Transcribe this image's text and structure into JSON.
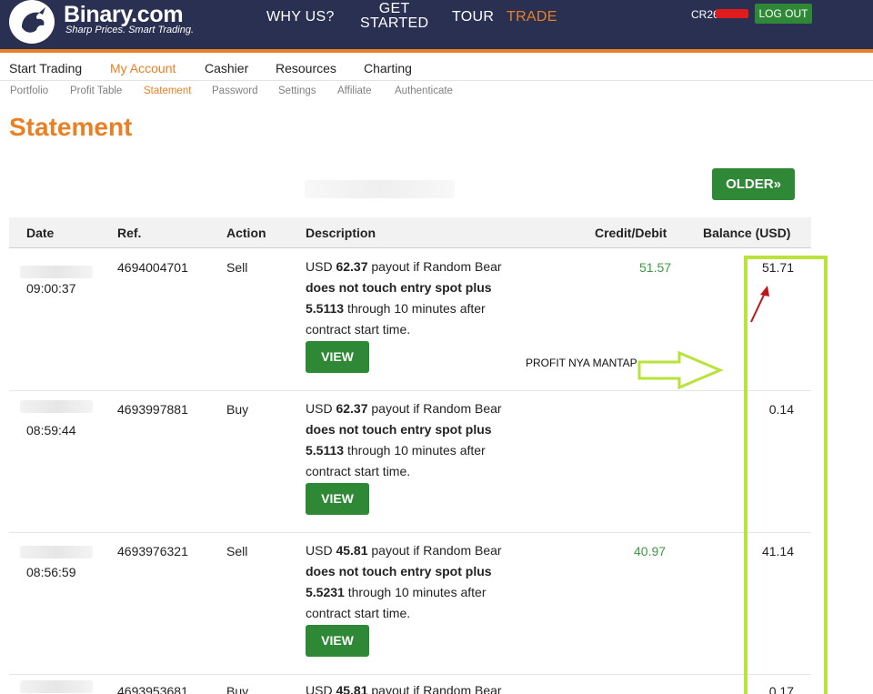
{
  "header": {
    "brand": "Binary.com",
    "tagline": "Sharp Prices. Smart Trading.",
    "nav": [
      {
        "label": "WHY US?"
      },
      {
        "label_line1": "GET",
        "label_line2": "STARTED"
      },
      {
        "label": "TOUR"
      },
      {
        "label": "TRADE"
      }
    ],
    "account_id_visible": "CR26",
    "logout_label": "LOG OUT"
  },
  "main_menu": [
    "Start Trading",
    "My Account",
    "Cashier",
    "Resources",
    "Charting"
  ],
  "sub_menu": [
    "Portfolio",
    "Profit Table",
    "Statement",
    "Password",
    "Settings",
    "Affiliate",
    "Authenticate"
  ],
  "page_title": "Statement",
  "older_button": "OLDER»",
  "table": {
    "columns": [
      "Date",
      "Ref.",
      "Action",
      "Description",
      "Credit/Debit",
      "Balance (USD)"
    ],
    "view_label": "VIEW",
    "rows": [
      {
        "time": "09:00:37",
        "ref": "4694004701",
        "action": "Sell",
        "d1": "USD ",
        "d2": "62.37",
        "d3": " payout if Random Bear",
        "d4": "does not touch entry spot plus",
        "d5": "5.5113",
        "d6": " through 10 minutes after",
        "d7": "contract start time.",
        "credit": "51.57",
        "balance": "51.71"
      },
      {
        "time": "08:59:44",
        "ref": "4693997881",
        "action": "Buy",
        "d1": "USD ",
        "d2": "62.37",
        "d3": " payout if Random Bear",
        "d4": "does not touch entry spot plus",
        "d5": "5.5113",
        "d6": " through 10 minutes after",
        "d7": "contract start time.",
        "credit": "",
        "balance": "0.14"
      },
      {
        "time": "08:56:59",
        "ref": "4693976321",
        "action": "Sell",
        "d1": "USD ",
        "d2": "45.81",
        "d3": " payout if Random Bear",
        "d4": "does not touch entry spot plus",
        "d5": "5.5231",
        "d6": " through 10 minutes after",
        "d7": "contract start time.",
        "credit": "40.97",
        "balance": "41.14"
      },
      {
        "time": "",
        "ref": "4693953681",
        "action": "Buy",
        "d1": "USD ",
        "d2": "45.81",
        "d3": " payout if Random Bear",
        "d4": "",
        "d5": "",
        "d6": "",
        "d7": "",
        "credit": "",
        "balance": "0.17"
      }
    ]
  },
  "annotation": {
    "text": "PROFIT NYA MANTAP",
    "highlight_color": "#b9e33b",
    "arrow_color": "#c0141c"
  },
  "colors": {
    "header_bg": "#2a3052",
    "accent_orange": "#e98024",
    "button_green": "#2e8836",
    "credit_green": "#3d9a45"
  }
}
